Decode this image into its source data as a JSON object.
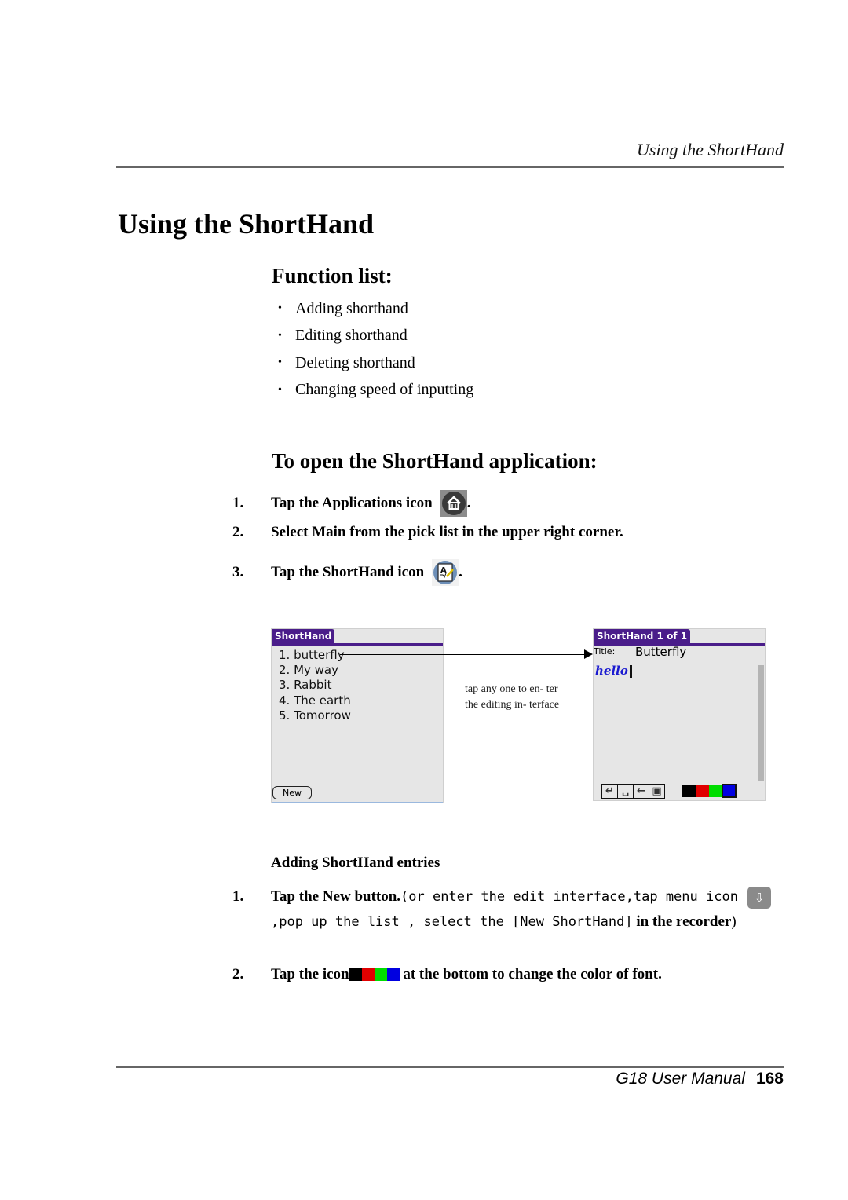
{
  "header": {
    "running_title": "Using the ShortHand"
  },
  "page_title": "Using the ShortHand",
  "function_list": {
    "title": "Function list:",
    "items": [
      "Adding shorthand",
      "Editing shorthand",
      "Deleting shorthand",
      "Changing speed of inputting"
    ]
  },
  "open_app": {
    "title": "To open the ShortHand application:",
    "steps": [
      {
        "num": "1.",
        "text": "Tap the Applications icon",
        "icon": "applications-home-icon",
        "after": "."
      },
      {
        "num": "2.",
        "text": "Select Main from the pick list in the upper right corner."
      },
      {
        "num": "3.",
        "text": "Tap the ShortHand icon",
        "icon": "shorthand-app-icon",
        "after": "."
      }
    ]
  },
  "screens": {
    "list_screen": {
      "title": "ShortHand",
      "entries": [
        "1. butterfly",
        "2. My way",
        "3. Rabbit",
        "4. The earth",
        "5. Tomorrow"
      ],
      "new_button": "New"
    },
    "caption": "tap any one to en- ter the editing in- terface",
    "edit_screen": {
      "title": "ShortHand 1 of 1",
      "title_label": "Title:",
      "title_value": "Butterfly",
      "ink_text": "hello",
      "tools": [
        {
          "name": "enter-icon",
          "glyph": "↵"
        },
        {
          "name": "space-icon",
          "glyph": "␣"
        },
        {
          "name": "backspace-icon",
          "glyph": "←"
        },
        {
          "name": "save-icon",
          "glyph": "▣"
        }
      ],
      "colors": [
        {
          "name": "black",
          "hex": "#000000"
        },
        {
          "name": "red",
          "hex": "#e00000"
        },
        {
          "name": "green",
          "hex": "#00dd00"
        },
        {
          "name": "blue",
          "hex": "#0000e0",
          "selected": true
        }
      ]
    }
  },
  "adding": {
    "heading": "Adding ShortHand entries",
    "step1": {
      "num": "1.",
      "bold_lead": "Tap the New button.",
      "mono_1": "(or enter the edit interface,tap menu icon ",
      "mono_2": ",pop up the list , select the [New ShortHand]",
      "bold_tail": " in the recorder",
      "close": ")"
    },
    "step2": {
      "num": "2.",
      "lead": "Tap the icon",
      "tail": " at the bottom to change the color of font."
    }
  },
  "footer": {
    "manual": "G18 User Manual",
    "page": "168"
  }
}
